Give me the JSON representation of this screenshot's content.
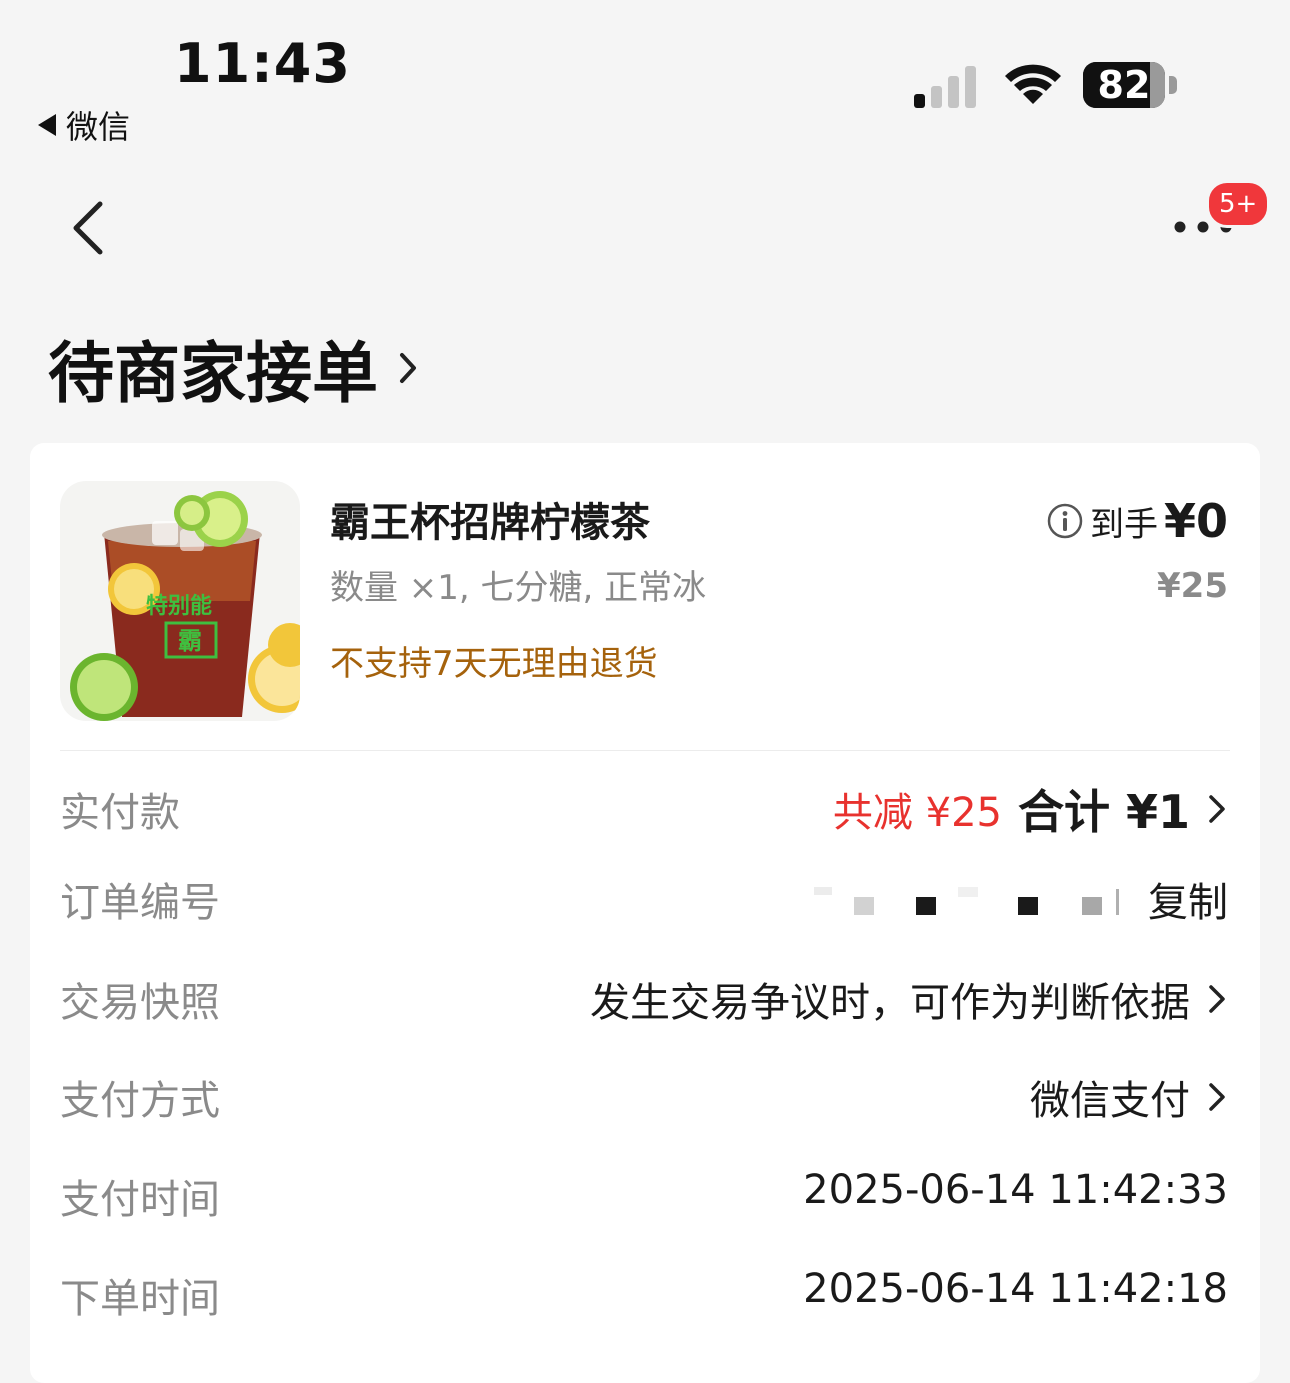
{
  "status_bar": {
    "time": "11:43",
    "back_app": "微信",
    "battery": "82",
    "battery_level": 0.82,
    "signal_bars_active": 1
  },
  "nav": {
    "badge": "5+"
  },
  "order": {
    "status_title": "待商家接单"
  },
  "product": {
    "name": "霸王杯招牌柠檬茶",
    "spec": "数量 ×1, 七分糖, 正常冰",
    "policy": "不支持7天无理由退货",
    "net_price_label": "到手",
    "net_price_value": "¥0",
    "list_price": "¥25",
    "image_caption": "特别能",
    "image_char": "霸",
    "colors": {
      "policy": "#a5620c",
      "reduction": "#e8322e",
      "badge": "#f0373b"
    }
  },
  "details": {
    "paid": {
      "label": "实付款",
      "reduction": "共减 ¥25",
      "total": "合计 ¥1"
    },
    "order_no": {
      "label": "订单编号",
      "copy": "复制"
    },
    "snapshot": {
      "label": "交易快照",
      "value": "发生交易争议时，可作为判断依据"
    },
    "payment_method": {
      "label": "支付方式",
      "value": "微信支付"
    },
    "payment_time": {
      "label": "支付时间",
      "value": "2025-06-14 11:42:33"
    },
    "order_time": {
      "label": "下单时间",
      "value": "2025-06-14 11:42:18"
    }
  }
}
